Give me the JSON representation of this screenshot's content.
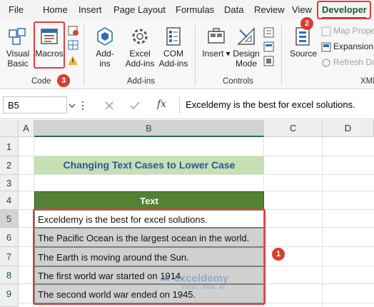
{
  "ribbon_tabs": [
    "File",
    "Home",
    "Insert",
    "Page Layout",
    "Formulas",
    "Data",
    "Review",
    "View",
    "Developer"
  ],
  "code_group": {
    "visual_basic": "Visual Basic",
    "visual_basic_l1": "Visual",
    "visual_basic_l2": "Basic",
    "macros": "Macros",
    "label": "Code"
  },
  "addins_group": {
    "addins_l1": "Add-",
    "addins_l2": "ins",
    "excel_l1": "Excel",
    "excel_l2": "Add-ins",
    "com_l1": "COM",
    "com_l2": "Add-ins",
    "label": "Add-ins"
  },
  "controls_group": {
    "insert": "Insert",
    "design_l1": "Design",
    "design_l2": "Mode",
    "label": "Controls"
  },
  "xml_group": {
    "source": "Source",
    "map_properties": "Map Prope",
    "expansion": "Expansion",
    "refresh_data": "Refresh Da",
    "label": "XML"
  },
  "formula_bar": {
    "name_box": "B5",
    "fx": "fx",
    "formula": "Exceldemy is the best for excel solutions."
  },
  "columns": [
    "A",
    "B",
    "C",
    "D"
  ],
  "rows": [
    "1",
    "2",
    "3",
    "4",
    "5",
    "6",
    "7",
    "8",
    "9"
  ],
  "sheet": {
    "title": "Changing Text Cases to Lower Case",
    "header": "Text",
    "data": [
      "Exceldemy is the best for excel solutions.",
      "The Pacific Ocean is the largest ocean in the world.",
      "The Earth is moving around the Sun.",
      "The first world war started on 1914.",
      "The second world war ended on 1945."
    ]
  },
  "annotations": {
    "badge_1": "1",
    "badge_2": "2",
    "badge_3": "3"
  },
  "watermark": {
    "name": "exceldemy",
    "tagline": "EXCEL · DATA · BI"
  },
  "colors": {
    "accent": "#217346",
    "title_fill": "#c5e0b4",
    "title_text": "#2f5597",
    "header_fill": "#548235",
    "selected_fill": "#d0d0d0",
    "annotation": "#e23d3d"
  }
}
